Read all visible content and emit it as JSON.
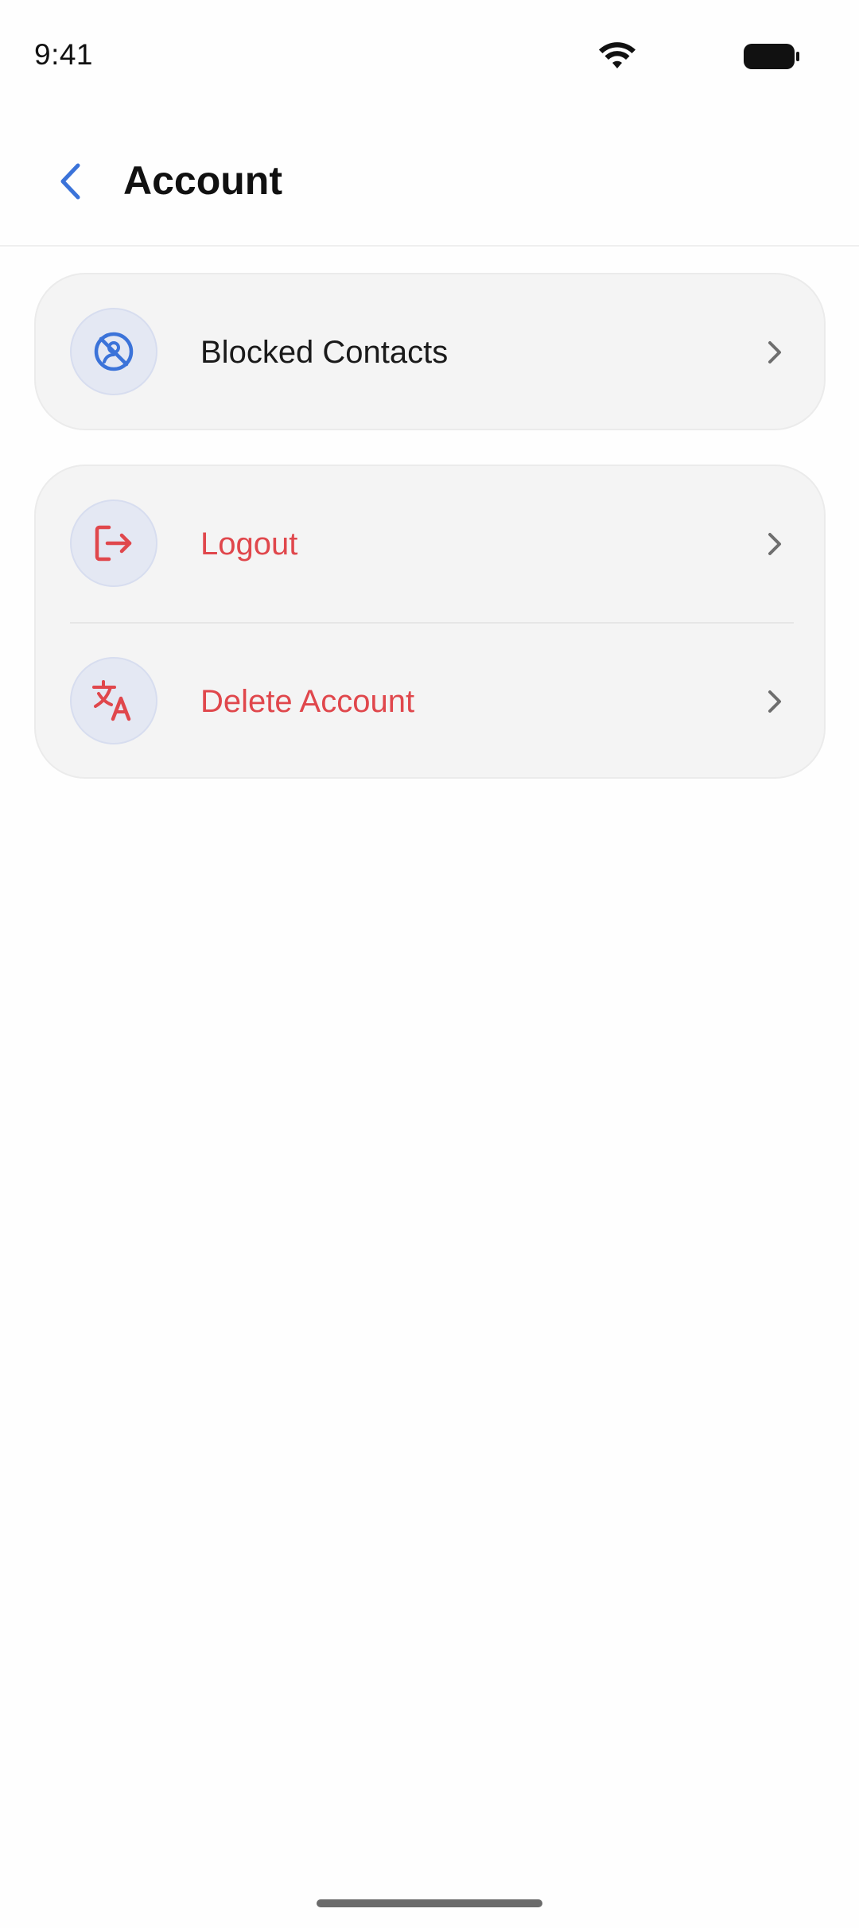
{
  "status_bar": {
    "time": "9:41"
  },
  "header": {
    "title": "Account"
  },
  "sections": [
    {
      "items": [
        {
          "label": "Blocked Contacts",
          "icon": "blocked-contacts-icon"
        }
      ]
    },
    {
      "items": [
        {
          "label": "Logout",
          "icon": "logout-icon"
        },
        {
          "label": "Delete Account",
          "icon": "translate-icon"
        }
      ]
    }
  ],
  "colors": {
    "accent": "#3b73d9",
    "danger": "#e0474c",
    "card_bg": "#f4f4f4",
    "icon_circle_bg": "#e4e8f3"
  }
}
